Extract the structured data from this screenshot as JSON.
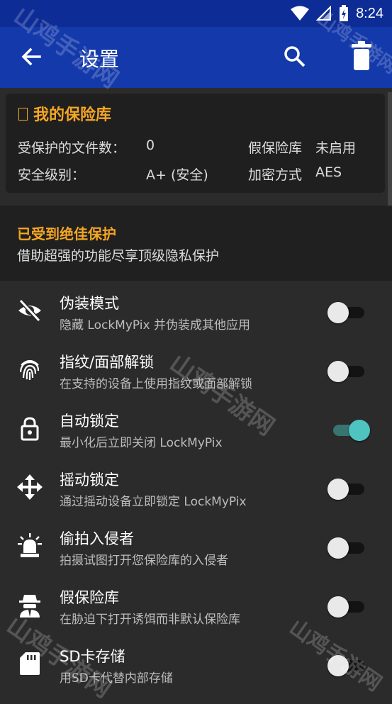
{
  "status_bar": {
    "time": "8:24"
  },
  "app_bar": {
    "title": "设置"
  },
  "vault": {
    "title": "我的保险库",
    "files_label": "受保护的文件数：",
    "files_value": "0",
    "fake_vault_label": "假保险库",
    "fake_vault_value": "未启用",
    "security_label": "安全级别：",
    "security_value": "A+ (安全)",
    "encryption_label": "加密方式",
    "encryption_value": "AES"
  },
  "promo": {
    "title": "已受到绝佳保护",
    "subtitle": "借助超强的功能尽享顶级隐私保护"
  },
  "settings": [
    {
      "title": "伪装模式",
      "subtitle": "隐藏 LockMyPix 并伪装成其他应用",
      "icon": "eye-off-icon",
      "enabled": false
    },
    {
      "title": "指纹/面部解锁",
      "subtitle": "在支持的设备上使用指纹或面部解锁",
      "icon": "fingerprint-icon",
      "enabled": false
    },
    {
      "title": "自动锁定",
      "subtitle": "最小化后立即关闭 LockMyPix",
      "icon": "lock-icon",
      "enabled": true
    },
    {
      "title": "摇动锁定",
      "subtitle": "通过摇动设备立即锁定 LockMyPix",
      "icon": "move-arrows-icon",
      "enabled": false
    },
    {
      "title": "偷拍入侵者",
      "subtitle": "拍摄试图打开您保险库的入侵者",
      "icon": "alarm-light-icon",
      "enabled": false
    },
    {
      "title": "假保险库",
      "subtitle": "在胁迫下打开诱饵而非默认保险库",
      "icon": "spy-icon",
      "enabled": false
    },
    {
      "title": "SD卡存储",
      "subtitle": "用SD卡代替内部存储",
      "icon": "sd-card-icon",
      "enabled": false
    }
  ],
  "watermark": "山鸡手游网",
  "colors": {
    "app_bar": "#1339aa",
    "accent": "#f5a623",
    "switch_on": "#4fc3c0"
  }
}
